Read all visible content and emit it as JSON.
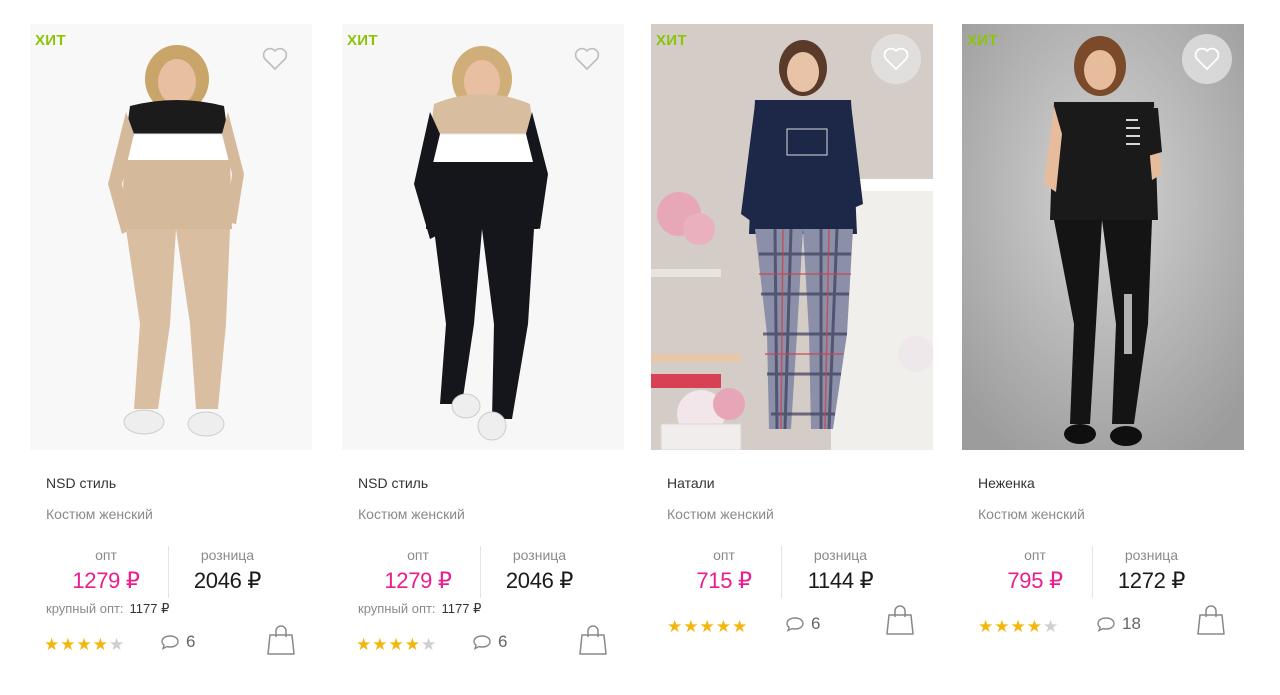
{
  "products": [
    {
      "badge": "ХИТ",
      "brand": "NSD стиль",
      "type": "Костюм женский",
      "opt_label": "опт",
      "opt_price": "1279 ₽",
      "retail_label": "розница",
      "retail_price": "2046 ₽",
      "bulk_label": "крупный опт:",
      "bulk_price": "1177 ₽",
      "rating": 4,
      "comments": "6",
      "favorite_style": "outline"
    },
    {
      "badge": "ХИТ",
      "brand": "NSD стиль",
      "type": "Костюм женский",
      "opt_label": "опт",
      "opt_price": "1279 ₽",
      "retail_label": "розница",
      "retail_price": "2046 ₽",
      "bulk_label": "крупный опт:",
      "bulk_price": "1177 ₽",
      "rating": 4,
      "comments": "6",
      "favorite_style": "outline"
    },
    {
      "badge": "ХИТ",
      "brand": "Натали",
      "type": "Костюм женский",
      "opt_label": "опт",
      "opt_price": "715 ₽",
      "retail_label": "розница",
      "retail_price": "1144 ₽",
      "rating": 5,
      "comments": "6",
      "favorite_style": "filled"
    },
    {
      "badge": "ХИТ",
      "brand": "Неженка",
      "type": "Костюм женский",
      "opt_label": "опт",
      "opt_price": "795 ₽",
      "retail_label": "розница",
      "retail_price": "1272 ₽",
      "rating": 4,
      "comments": "18",
      "favorite_style": "filled"
    }
  ],
  "colors": {
    "badge": "#8cc40a",
    "opt_price": "#ec1c8c",
    "star": "#f2b70e"
  },
  "icons": {
    "favorite": "heart-icon",
    "comments": "speech-bubble-icon",
    "cart": "shopping-bag-icon",
    "rating": "star-icon"
  }
}
